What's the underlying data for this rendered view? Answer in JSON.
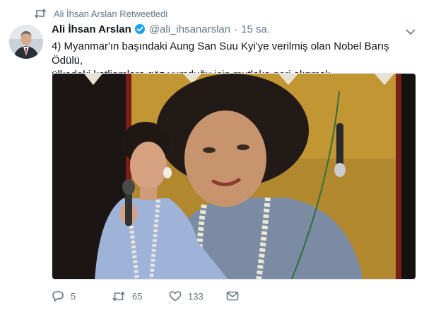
{
  "retweet_context": {
    "icon": "retweet-icon",
    "text": "Ali İhsan Arslan Retweetledi"
  },
  "tweet": {
    "author_name": "Ali İhsan Arslan",
    "verified": true,
    "handle": "@ali_ihsanarslan",
    "separator": "·",
    "time": "15 sa.",
    "text_line1": "4) Myanmar'ın başındaki Aung San Suu Kyi'ye verilmiş olan Nobel Barış Ödülü,",
    "text_line2": "ülkedeki katliamlara göz yumduğu için mutlaka geri alınmalı."
  },
  "actions": {
    "reply_count": "5",
    "retweet_count": "65",
    "like_count": "133"
  },
  "colors": {
    "text": "#14171a",
    "secondary": "#657786",
    "verified": "#1da1f2",
    "border": "#e1e8ed"
  }
}
